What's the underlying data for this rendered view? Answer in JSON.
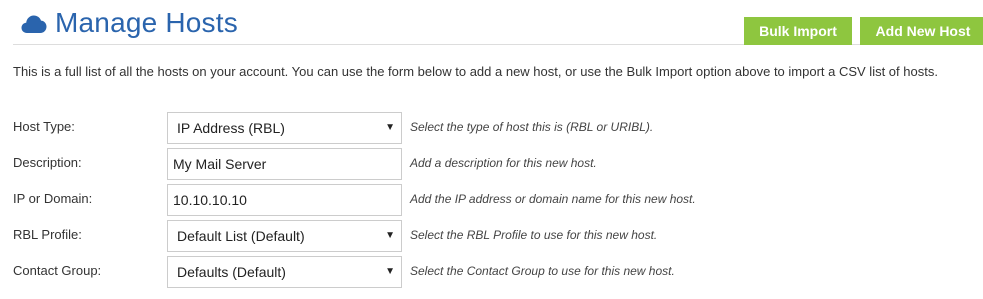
{
  "header": {
    "title": "Manage Hosts",
    "icon": "cloud-icon",
    "accent_color": "#2a64ad"
  },
  "toolbar": {
    "bulk_import_label": "Bulk Import",
    "add_new_host_label": "Add New Host",
    "button_color": "#8ec63f"
  },
  "intro": {
    "text": "This is a full list of all the hosts on your account. You can use the form below to add a new host, or use the Bulk Import option above to import a CSV list of hosts."
  },
  "form": {
    "host_type": {
      "label": "Host Type:",
      "value": "IP Address (RBL)",
      "help": "Select the type of host this is (RBL or URIBL)."
    },
    "description": {
      "label": "Description:",
      "value": "My Mail Server",
      "help": "Add a description for this new host."
    },
    "ip_or_domain": {
      "label": "IP or Domain:",
      "value": "10.10.10.10",
      "help": "Add the IP address or domain name for this new host."
    },
    "rbl_profile": {
      "label": "RBL Profile:",
      "value": "Default List (Default)",
      "help": "Select the RBL Profile to use for this new host."
    },
    "contact_group": {
      "label": "Contact Group:",
      "value": "Defaults (Default)",
      "help": "Select the Contact Group to use for this new host."
    }
  }
}
